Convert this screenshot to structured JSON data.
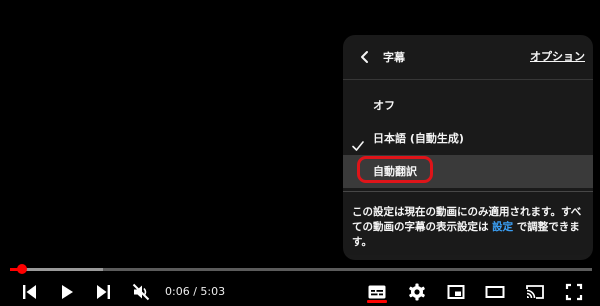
{
  "panel": {
    "title": "字幕",
    "options_label": "オプション",
    "items": [
      {
        "label": "オフ",
        "selected": false
      },
      {
        "label": "日本語 (自動生成)",
        "selected": true
      },
      {
        "label": "自動翻訳",
        "selected": false,
        "highlighted": true
      }
    ],
    "note_part1": "この設定は現在の動画にのみ適用されます。すべての動画の字幕の表示設定は ",
    "note_link": "設定",
    "note_part2": " で調整できます。"
  },
  "player": {
    "current_time": "0:06",
    "duration": "5:03",
    "time_separator": " / ",
    "progress_fraction": 0.02,
    "buffered_fraction": 0.16
  },
  "colors": {
    "accent": "#ff0000",
    "highlight_ring": "#e8151b",
    "link": "#3ea6ff",
    "panel_bg": "#1c1c1c"
  },
  "icons": [
    "chevron-left-icon",
    "checkmark-icon",
    "skip-previous-icon",
    "play-icon",
    "skip-next-icon",
    "volume-muted-icon",
    "subtitles-icon",
    "gear-icon",
    "miniplayer-icon",
    "theater-mode-icon",
    "cast-icon",
    "fullscreen-icon"
  ]
}
